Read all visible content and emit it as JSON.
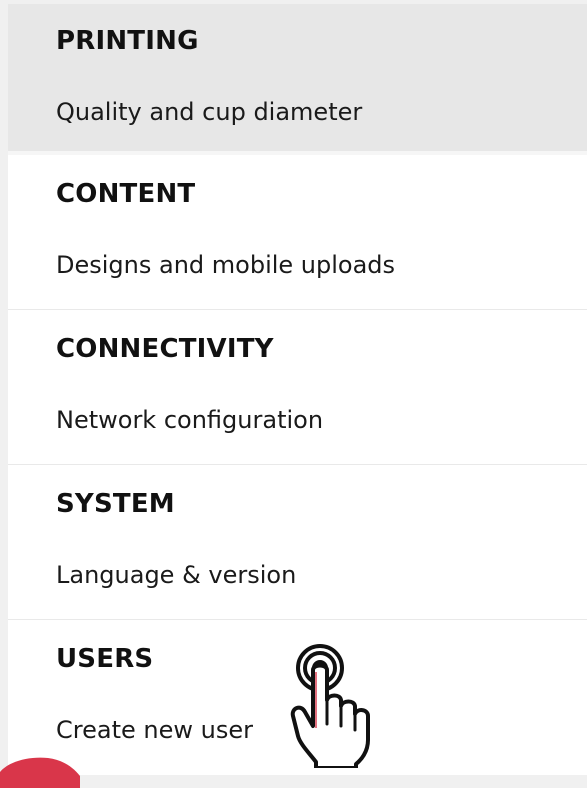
{
  "menu": {
    "items": [
      {
        "title": "PRINTING",
        "subtitle": "Quality and cup diameter",
        "state": "selected"
      },
      {
        "title": "CONTENT",
        "subtitle": "Designs and mobile uploads"
      },
      {
        "title": "CONNECTIVITY",
        "subtitle": "Network configuration"
      },
      {
        "title": "SYSTEM",
        "subtitle": "Language & version"
      },
      {
        "title": "USERS",
        "subtitle": "Create new user"
      }
    ]
  },
  "icons": {
    "tap_hint": "tap-hand-icon",
    "corner_decoration": "red-corner-shape"
  },
  "colors": {
    "selected_background": "#e7e7e7",
    "item_background": "#ffffff",
    "divider": "#e9e9e9",
    "text": "#111111",
    "accent_red": "#d9364a"
  }
}
